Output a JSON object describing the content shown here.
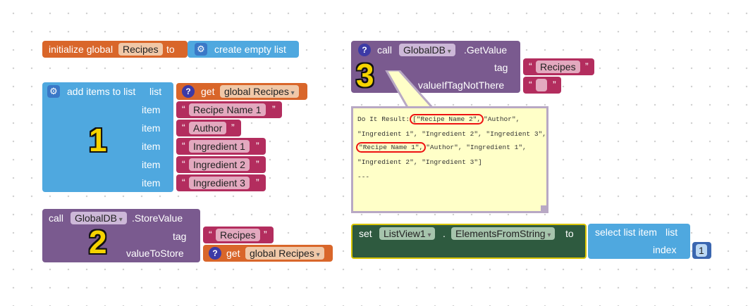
{
  "init_block": {
    "label": "initialize global",
    "var_name": "Recipes",
    "to": "to",
    "create_list": "create empty list"
  },
  "add_items_block": {
    "label": "add items to list",
    "list_label": "list",
    "get_label": "get",
    "get_var": "global Recipes",
    "item_label": "item",
    "items": [
      "Recipe Name 1",
      "Author",
      "Ingredient 1",
      "Ingredient 2",
      "Ingredient 3"
    ],
    "number": "1"
  },
  "store_block": {
    "call": "call",
    "component": "GlobalDB",
    "method": ".StoreValue",
    "tag_label": "tag",
    "tag_value": "Recipes",
    "value_label": "valueToStore",
    "get_label": "get",
    "get_var": "global Recipes",
    "number": "2"
  },
  "getvalue_block": {
    "call": "call",
    "component": "GlobalDB",
    "method": ".GetValue",
    "tag_label": "tag",
    "tag_value": "Recipes",
    "value_label": "valueIfTagNotThere",
    "number": "3"
  },
  "result_bubble": {
    "prefix": "Do It Result:",
    "hl1": "[\"Recipe Name 2\",",
    "line1_rest": "\"Author\",",
    "line2": "\"Ingredient 1\", \"Ingredient 2\", \"Ingredient 3\",",
    "hl2": "\"Recipe Name 1\",",
    "line3_rest": "\"Author\", \"Ingredient 1\",",
    "line4": "\"Ingredient 2\", \"Ingredient 3\"]",
    "line5": "---"
  },
  "set_block": {
    "set": "set",
    "component": "ListView1",
    "dot": ".",
    "property": "ElementsFromString",
    "to": "to",
    "select_label": "select list item",
    "list_label": "list",
    "index_label": "index",
    "index_value": "1"
  },
  "colors": {
    "orange": "#d9662a",
    "blue": "#4fa8df",
    "purple": "#7a5a8f",
    "magenta": "#b32d5e",
    "green": "#2e5a3f",
    "number_yellow": "#f5d300"
  }
}
